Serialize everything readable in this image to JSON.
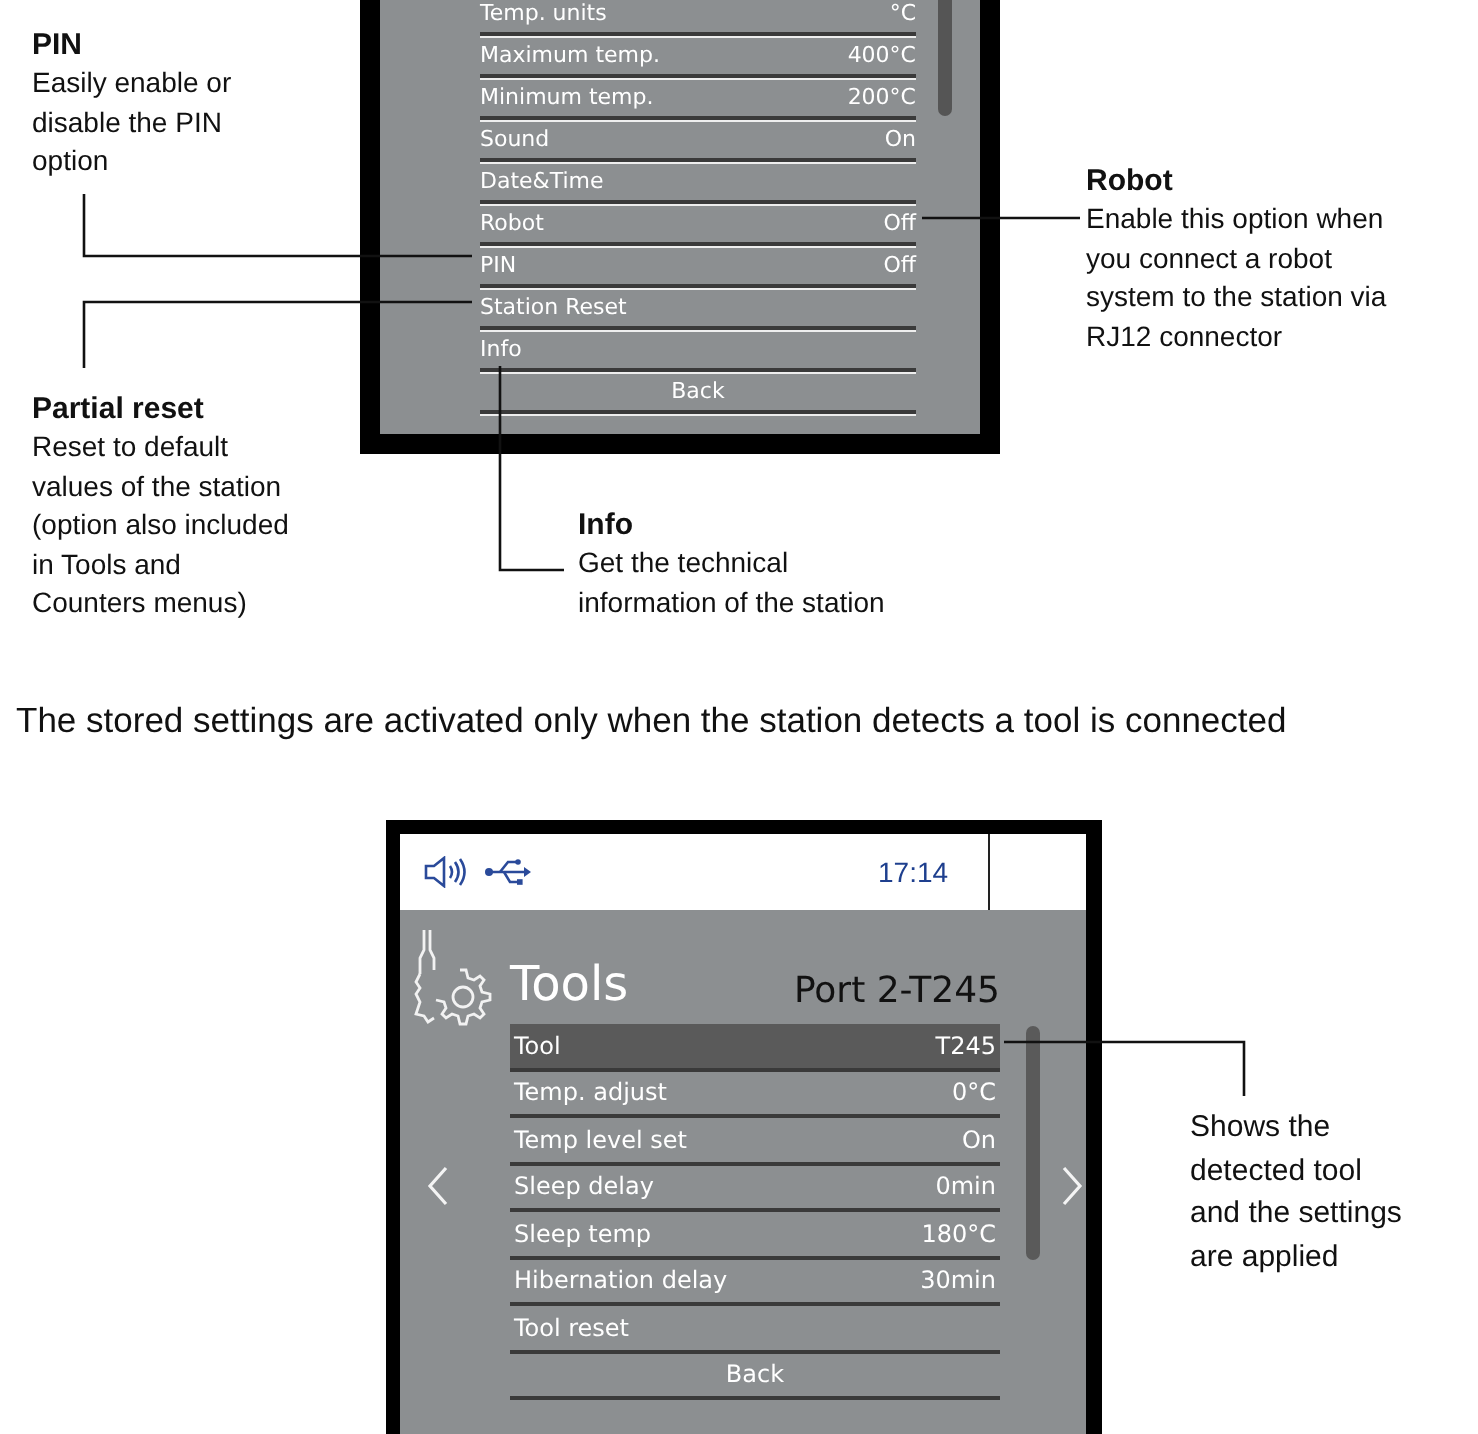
{
  "settings_screen": {
    "rows": [
      {
        "kind": "item",
        "label": "Temp. units",
        "value": "°C",
        "selected": false
      },
      {
        "kind": "item",
        "label": "Maximum temp.",
        "value": "400°C",
        "selected": false
      },
      {
        "kind": "item",
        "label": "Minimum temp.",
        "value": "200°C",
        "selected": false
      },
      {
        "kind": "item",
        "label": "Sound",
        "value": "On",
        "selected": false
      },
      {
        "kind": "item",
        "label": "Date&Time",
        "selected": false
      },
      {
        "kind": "item",
        "label": "Robot",
        "value": "Off",
        "selected": false
      },
      {
        "kind": "item",
        "label": "PIN",
        "value": "Off",
        "selected": false
      },
      {
        "kind": "item",
        "label": "Station Reset",
        "selected": false
      },
      {
        "kind": "item",
        "label": "Info",
        "selected": false
      },
      {
        "kind": "back",
        "label": "Back",
        "selected": false
      }
    ]
  },
  "callouts": [
    {
      "title": "PIN",
      "lines": [
        "Easily enable or",
        "disable the PIN",
        "option"
      ]
    },
    {
      "title": "Partial reset",
      "lines": [
        "Reset to default",
        "values of the station",
        "(option also included",
        "in Tools and",
        "Counters menus)"
      ]
    },
    {
      "title": "Info",
      "lines": [
        "Get the technical",
        "information of the station"
      ]
    },
    {
      "title": "Robot",
      "lines": [
        "Enable this option when",
        "you connect a robot",
        "system to the station via",
        "RJ12 connector"
      ]
    }
  ],
  "note": "The stored settings are activated only when the station detects a tool is connected",
  "tools_screen": {
    "time": "17:14",
    "title": "Tools",
    "port": "Port 2-T245",
    "rows": [
      {
        "kind": "item",
        "label": "Tool",
        "value": "T245",
        "selected": true
      },
      {
        "kind": "item",
        "label": "Temp. adjust",
        "value": "0°C",
        "selected": false
      },
      {
        "kind": "item",
        "label": "Temp level set",
        "value": "On",
        "selected": false
      },
      {
        "kind": "item",
        "label": "Sleep delay",
        "value": "0min",
        "selected": false
      },
      {
        "kind": "item",
        "label": "Sleep temp",
        "value": "180°C",
        "selected": false
      },
      {
        "kind": "item",
        "label": "Hibernation delay",
        "value": "30min",
        "selected": false
      },
      {
        "kind": "item",
        "label": "Tool reset",
        "selected": false
      },
      {
        "kind": "back",
        "label": "Back",
        "selected": false
      }
    ]
  },
  "tool_callout": {
    "lines": [
      "Shows the",
      "detected tool",
      "and the settings",
      "are applied"
    ]
  }
}
